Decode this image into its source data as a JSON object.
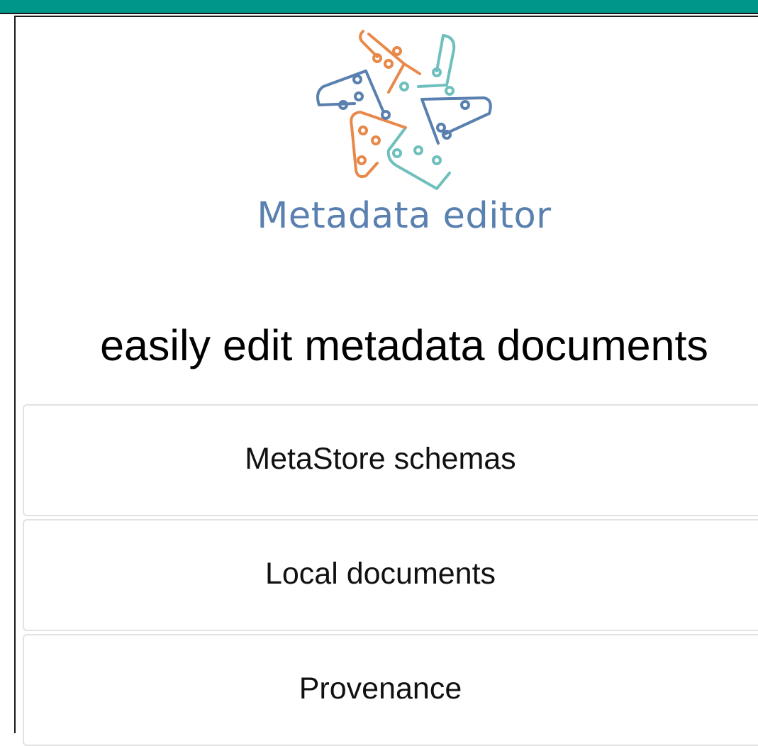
{
  "app": {
    "name": "Metadata editor",
    "tagline": "easily edit metadata documents"
  },
  "menu": {
    "items": [
      {
        "label": "MetaStore schemas"
      },
      {
        "label": "Local documents"
      },
      {
        "label": "Provenance"
      }
    ]
  },
  "colors": {
    "top_bar": "#00968a",
    "logo_orange": "#e8894a",
    "logo_teal": "#6fc0bd",
    "logo_blue": "#5a80b0",
    "app_name": "#5a80b0"
  },
  "icons": {
    "logo": "metadata-editor-logo-icon"
  }
}
